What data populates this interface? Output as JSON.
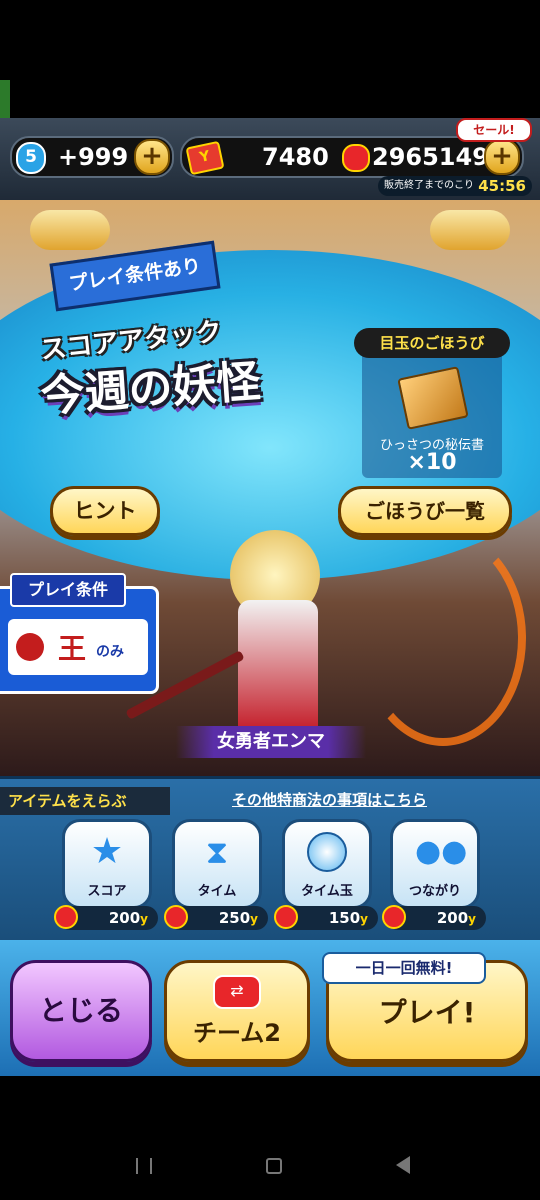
{
  "topbar": {
    "stamina_level": "5",
    "stamina_value": "+999",
    "currency_amount": "7480",
    "coins_amount": "2965149",
    "sale_badge": "セール!",
    "sale_timer_label": "販売終了までのこり",
    "sale_timer": "45:56"
  },
  "event": {
    "condition_badge": "プレイ条件あり",
    "subtitle": "スコアアタック",
    "title": "今週の妖怪",
    "reward_header": "目玉のごほうび",
    "reward_item": "ひっさつの秘伝書",
    "reward_qty": "×10",
    "hint_button": "ヒント",
    "reward_list_button": "ごほうび一覧",
    "play_condition_header": "プレイ条件",
    "play_condition_value": "王",
    "play_condition_suffix": "のみ",
    "character_name": "女勇者エンマ"
  },
  "items": {
    "header": "アイテムをえらぶ",
    "legal_link": "その他特商法の事項はこちら",
    "list": [
      {
        "label": "スコア",
        "price": "200",
        "icon": "star-icon"
      },
      {
        "label": "タイム",
        "price": "250",
        "icon": "hourglass-icon"
      },
      {
        "label": "タイム玉",
        "price": "150",
        "icon": "time-orb-icon"
      },
      {
        "label": "つながり",
        "price": "200",
        "icon": "link-icon"
      }
    ],
    "currency_suffix": "y"
  },
  "bottom": {
    "close_button": "とじる",
    "team_button": "チーム2",
    "play_button": "プレイ!",
    "free_badge": "一日一回無料!"
  },
  "colors": {
    "accent_blue": "#1fb0e8",
    "gold": "#ffd659",
    "banner_purple": "#6b3fb8"
  }
}
